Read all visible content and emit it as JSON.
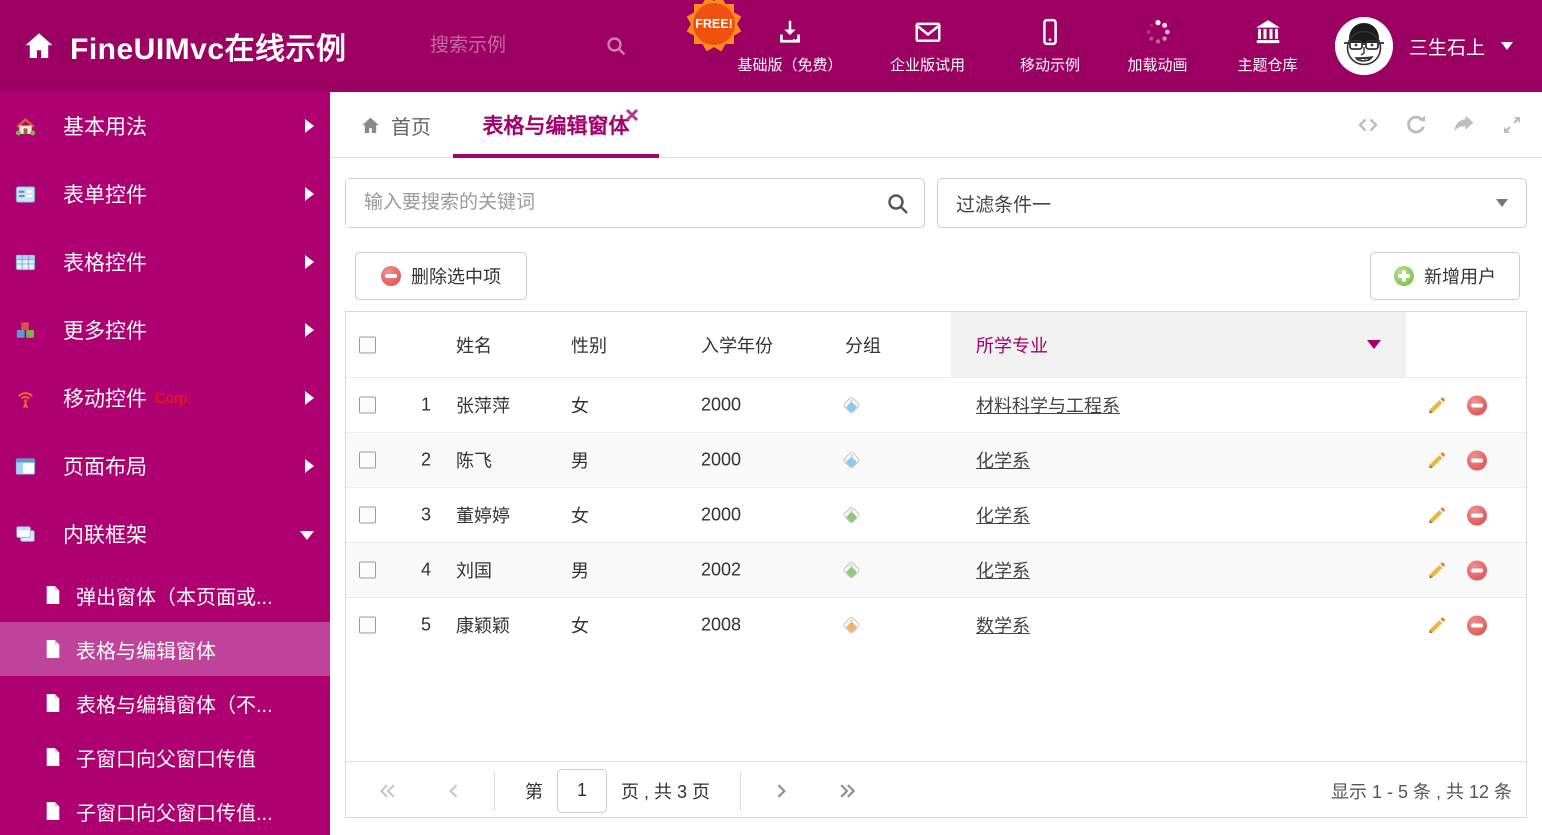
{
  "colors": {
    "header_bg": "#9C0062",
    "sidebar_bg": "#AE0071",
    "sidebar_selected_bg": "#C0439B",
    "accent": "#A2006B",
    "free_badge": "#FB8C1E",
    "delete_red": "#DD4747",
    "add_green": "#6FBE44",
    "edit_pencil": "#EDB53F"
  },
  "header": {
    "title": "FineUIMvc在线示例",
    "search_placeholder": "搜索示例",
    "free_badge": "FREE!",
    "nav": [
      {
        "label": "基础版（免费）",
        "icon": "download-icon"
      },
      {
        "label": "企业版试用",
        "icon": "envelope-icon"
      },
      {
        "label": "移动示例",
        "icon": "mobile-icon"
      },
      {
        "label": "加载动画",
        "icon": "spinner-icon"
      },
      {
        "label": "主题仓库",
        "icon": "bank-icon"
      }
    ],
    "user": "三生石上"
  },
  "sidebar": {
    "items": [
      {
        "label": "基本用法",
        "icon": "house-icon"
      },
      {
        "label": "表单控件",
        "icon": "form-icon"
      },
      {
        "label": "表格控件",
        "icon": "table-icon"
      },
      {
        "label": "更多控件",
        "icon": "cubes-icon"
      },
      {
        "label": "移动控件",
        "badge": "Corp.",
        "icon": "antenna-icon"
      },
      {
        "label": "页面布局",
        "icon": "layout-icon"
      },
      {
        "label": "内联框架",
        "icon": "frames-icon"
      }
    ],
    "children": [
      {
        "label": "弹出窗体（本页面或..."
      },
      {
        "label": "表格与编辑窗体",
        "selected": true
      },
      {
        "label": "表格与编辑窗体（不..."
      },
      {
        "label": "子窗口向父窗口传值"
      },
      {
        "label": "子窗口向父窗口传值..."
      }
    ]
  },
  "tabbar": {
    "home_tab": "首页",
    "active_tab": "表格与编辑窗体"
  },
  "filters": {
    "search_placeholder": "输入要搜索的关键词",
    "filter_selected": "过滤条件一"
  },
  "actions": {
    "delete_selected": "删除选中项",
    "add_user": "新增用户"
  },
  "grid": {
    "columns": {
      "name": "姓名",
      "gender": "性别",
      "year": "入学年份",
      "group": "分组",
      "major": "所学专业"
    },
    "rows": [
      {
        "num": "1",
        "name": "张萍萍",
        "gender": "女",
        "year": "2000",
        "tag_color": "#8CC8F0",
        "major": "材料科学与工程系"
      },
      {
        "num": "2",
        "name": "陈飞",
        "gender": "男",
        "year": "2000",
        "tag_color": "#8CC8F0",
        "major": "化学系"
      },
      {
        "num": "3",
        "name": "董婷婷",
        "gender": "女",
        "year": "2000",
        "tag_color": "#93C77B",
        "major": "化学系"
      },
      {
        "num": "4",
        "name": "刘国",
        "gender": "男",
        "year": "2002",
        "tag_color": "#93C77B",
        "major": "化学系"
      },
      {
        "num": "5",
        "name": "康颖颖",
        "gender": "女",
        "year": "2008",
        "tag_color": "#F5B06E",
        "major": "数学系"
      }
    ]
  },
  "pager": {
    "label_page": "第",
    "page_value": "1",
    "label_total": "页 , 共 3 页",
    "summary": "显示 1 - 5 条 , 共 12 条"
  }
}
